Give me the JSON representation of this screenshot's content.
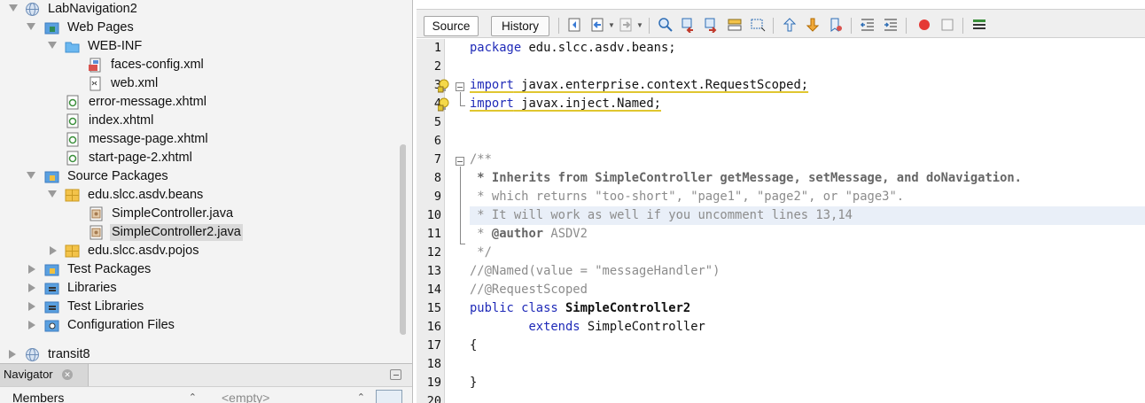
{
  "project_tree": {
    "items": [
      {
        "label": "LabNavigation2",
        "icon": "globe-icon",
        "expanded": true
      },
      {
        "label": "Web Pages",
        "icon": "web-pages-folder-icon",
        "expanded": true
      },
      {
        "label": "WEB-INF",
        "icon": "folder-icon",
        "expanded": true
      },
      {
        "label": "faces-config.xml",
        "icon": "faces-config-file-icon"
      },
      {
        "label": "web.xml",
        "icon": "xml-file-icon"
      },
      {
        "label": "error-message.xhtml",
        "icon": "xhtml-file-icon"
      },
      {
        "label": "index.xhtml",
        "icon": "xhtml-file-icon"
      },
      {
        "label": "message-page.xhtml",
        "icon": "xhtml-file-icon"
      },
      {
        "label": "start-page-2.xhtml",
        "icon": "xhtml-file-icon"
      },
      {
        "label": "Source Packages",
        "icon": "source-packages-icon",
        "expanded": true
      },
      {
        "label": "edu.slcc.asdv.beans",
        "icon": "package-icon",
        "expanded": true
      },
      {
        "label": "SimpleController.java",
        "icon": "java-file-icon"
      },
      {
        "label": "SimpleController2.java",
        "icon": "java-file-icon",
        "selected": true
      },
      {
        "label": "edu.slcc.asdv.pojos",
        "icon": "package-icon",
        "expanded": false
      },
      {
        "label": "Test Packages",
        "icon": "test-packages-icon",
        "expanded": false
      },
      {
        "label": "Libraries",
        "icon": "libraries-icon",
        "expanded": false
      },
      {
        "label": "Test Libraries",
        "icon": "test-libraries-icon",
        "expanded": false
      },
      {
        "label": "Configuration Files",
        "icon": "configuration-files-icon",
        "expanded": false
      },
      {
        "label": "transit8",
        "icon": "globe-icon",
        "expanded": false
      }
    ]
  },
  "navigator": {
    "tab_label": "Navigator",
    "members_label": "Members",
    "filter_value": "<empty>"
  },
  "editor": {
    "tabs": {
      "source": "Source",
      "history": "History"
    },
    "toolbar_icons": [
      "last-edit-icon",
      "back-icon",
      "forward-icon",
      "find-selection-icon",
      "find-previous-icon",
      "find-next-icon",
      "toggle-highlight-icon",
      "toggle-rect-selection-icon",
      "previous-bookmark-icon",
      "next-bookmark-icon",
      "toggle-bookmark-icon",
      "shift-left-icon",
      "shift-right-icon",
      "start-macro-icon",
      "stop-macro-icon",
      "comment-icon"
    ],
    "line_numbers": [
      "1",
      "2",
      "3",
      "4",
      "5",
      "6",
      "7",
      "8",
      "9",
      "10",
      "11",
      "12",
      "13",
      "14",
      "15",
      "16",
      "17",
      "18",
      "19",
      "20"
    ],
    "lines": {
      "l1": {
        "kw": "package",
        "rest": " edu.slcc.asdv.beans;"
      },
      "l3": {
        "kw": "import",
        "rest": " javax.enterprise.context.RequestScoped;"
      },
      "l4": {
        "kw": "import",
        "rest": " javax.inject.Named;"
      },
      "l7": "/**",
      "l8": " * Inherits from SimpleController getMessage, setMessage, and doNavigation.",
      "l9": " * which returns \"too-short\", \"page1\", \"page2\", or \"page3\".",
      "l10": " * It will work as well if you uncomment lines 13,14",
      "l11": {
        "pre": " * ",
        "tag": "@author",
        "rest": " ASDV2"
      },
      "l12": " */",
      "l13": "//@Named(value = \"messageHandler\")",
      "l14": "//@RequestScoped",
      "l15": {
        "kw": "public class ",
        "name": "SimpleController2"
      },
      "l16": {
        "indent": "        ",
        "kw": "extends",
        "rest": " SimpleController"
      },
      "l17": "{",
      "l19": "}"
    },
    "highlighted_line": 10
  },
  "colors": {
    "keyword": "#1f2ab8",
    "comment": "#8c8c8c",
    "squiggle": "#e0c630",
    "current_line": "#e9eff8"
  }
}
